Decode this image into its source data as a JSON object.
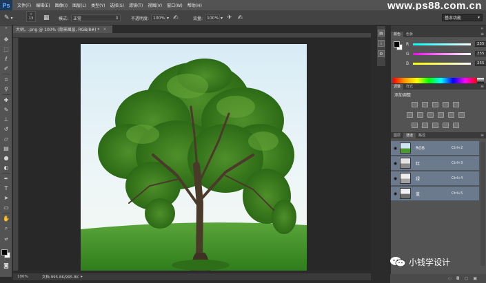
{
  "app": {
    "logo_text": "Ps",
    "brand_watermark": "www.ps88.com.cn"
  },
  "menu": [
    "文件(F)",
    "编辑(E)",
    "图像(I)",
    "图层(L)",
    "类型(Y)",
    "选择(S)",
    "滤镜(T)",
    "视图(V)",
    "窗口(W)",
    "帮助(H)"
  ],
  "options": {
    "brush_size": "13",
    "mode_label": "模式:",
    "mode_value": "正常",
    "opacity_label": "不透明度:",
    "opacity_value": "100%",
    "flow_label": "流量:",
    "flow_value": "100%",
    "workspace_value": "基本功能"
  },
  "document": {
    "tab_title": "大树。.png @ 100% (背景图层, RGB/8#) *",
    "status_zoom": "100%",
    "status_doc": "文档:995.8K/995.8K"
  },
  "color_panel": {
    "tabs": [
      "颜色",
      "色板"
    ],
    "channels": [
      {
        "label": "R",
        "value": "255",
        "color": "#ff4040"
      },
      {
        "label": "G",
        "value": "255",
        "color": "#40ff40"
      },
      {
        "label": "B",
        "value": "255",
        "color": "#4040ff"
      }
    ],
    "foreground": "#000000",
    "background": "#ffffff"
  },
  "adjustments_panel": {
    "tabs": [
      "调整",
      "样式"
    ],
    "title": "添加调整"
  },
  "channels_panel": {
    "tabs": [
      "图层",
      "通道",
      "路径"
    ],
    "rows": [
      {
        "name": "RGB",
        "shortcut": "Ctrl+2"
      },
      {
        "name": "红",
        "shortcut": "Ctrl+3"
      },
      {
        "name": "绿",
        "shortcut": "Ctrl+4"
      },
      {
        "name": "蓝",
        "shortcut": "Ctrl+5"
      }
    ]
  },
  "watermark": {
    "text": "小钱学设计"
  },
  "icons": {
    "toolbar": [
      "move-icon",
      "marquee-icon",
      "lasso-icon",
      "quick-select-icon",
      "crop-icon",
      "eyedropper-icon",
      "healing-icon",
      "brush-icon",
      "stamp-icon",
      "history-brush-icon",
      "eraser-icon",
      "gradient-icon",
      "blur-icon",
      "dodge-icon",
      "pen-icon",
      "type-icon",
      "path-select-icon",
      "shape-icon",
      "hand-icon",
      "zoom-icon"
    ]
  }
}
